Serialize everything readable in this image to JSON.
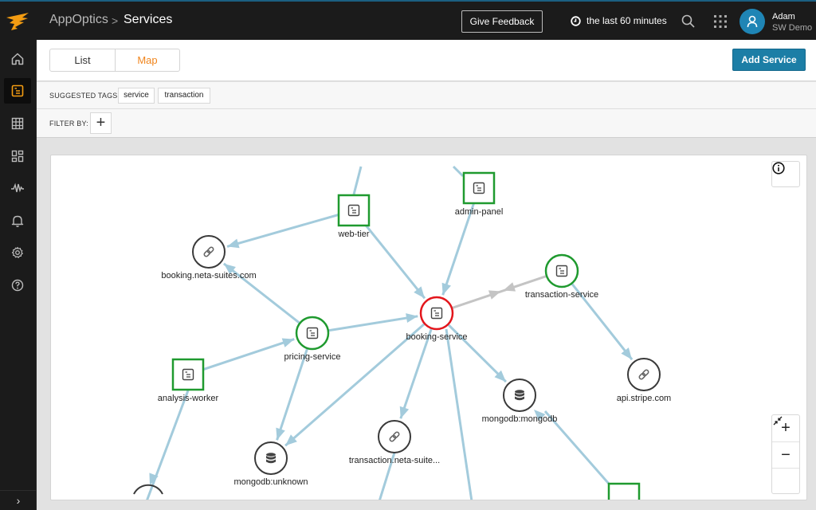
{
  "topbar": {
    "app_name": "AppOptics",
    "separator": ">",
    "page": "Services",
    "feedback_label": "Give Feedback",
    "time_range": "the last 60 minutes",
    "user_name": "Adam",
    "user_org": "SW Demo"
  },
  "sidebar": {
    "items": [
      {
        "name": "home",
        "icon": "home-icon",
        "active": false
      },
      {
        "name": "services",
        "icon": "services-icon",
        "active": true
      },
      {
        "name": "grid",
        "icon": "grid-icon",
        "active": false
      },
      {
        "name": "dashboards",
        "icon": "dashboards-icon",
        "active": false
      },
      {
        "name": "metrics",
        "icon": "pulse-icon",
        "active": false
      },
      {
        "name": "alerts",
        "icon": "bell-icon",
        "active": false
      },
      {
        "name": "settings",
        "icon": "gear-icon",
        "active": false
      },
      {
        "name": "help",
        "icon": "help-icon",
        "active": false
      }
    ],
    "expand_glyph": "›"
  },
  "header": {
    "tabs": [
      {
        "label": "List",
        "active": false
      },
      {
        "label": "Map",
        "active": true
      }
    ],
    "add_service_label": "Add Service"
  },
  "tags": {
    "label": "SUGGESTED TAGS:",
    "items": [
      "service",
      "transaction"
    ]
  },
  "filter": {
    "label": "FILTER BY:",
    "add_glyph": "+"
  },
  "map": {
    "zoom_in": "+",
    "zoom_out": "−",
    "colors": {
      "edge": "#a3cbdc",
      "edge_muted": "#c4c4c4",
      "healthy": "#1f9a2f",
      "error": "#e3161c",
      "neutral": "#3a3a3a"
    },
    "nodes": [
      {
        "id": "web-tier",
        "label": "web-tier",
        "shape": "square",
        "icon": "service-icon",
        "status": "healthy"
      },
      {
        "id": "admin-panel",
        "label": "admin-panel",
        "shape": "square",
        "icon": "service-icon",
        "status": "healthy"
      },
      {
        "id": "booking-neta",
        "label": "booking.neta-suites.com",
        "shape": "circle",
        "icon": "link-icon",
        "status": "neutral"
      },
      {
        "id": "transaction-service",
        "label": "transaction-service",
        "shape": "circle",
        "icon": "service-icon",
        "status": "healthy"
      },
      {
        "id": "booking-service",
        "label": "booking-service",
        "shape": "circle",
        "icon": "service-icon",
        "status": "error"
      },
      {
        "id": "pricing-service",
        "label": "pricing-service",
        "shape": "circle",
        "icon": "service-icon",
        "status": "healthy"
      },
      {
        "id": "analysis-worker",
        "label": "analysis-worker",
        "shape": "square",
        "icon": "service-icon",
        "status": "healthy"
      },
      {
        "id": "api-stripe",
        "label": "api.stripe.com",
        "shape": "circle",
        "icon": "link-icon",
        "status": "neutral"
      },
      {
        "id": "mongodb-mongodb",
        "label": "mongodb:mongodb",
        "shape": "circle",
        "icon": "database-icon",
        "status": "neutral"
      },
      {
        "id": "transaction-neta",
        "label": "transaction.neta-suite...",
        "shape": "circle",
        "icon": "link-icon",
        "status": "neutral"
      },
      {
        "id": "mongodb-unknown",
        "label": "mongodb:unknown",
        "shape": "circle",
        "icon": "database-icon",
        "status": "neutral"
      }
    ],
    "edges": [
      {
        "from": "web-tier",
        "to": "booking-neta"
      },
      {
        "from": "web-tier",
        "to": "booking-service"
      },
      {
        "from": "admin-panel",
        "to": "booking-service"
      },
      {
        "from": "transaction-service",
        "to": "booking-service",
        "muted": true
      },
      {
        "from": "transaction-service",
        "to": "api-stripe"
      },
      {
        "from": "pricing-service",
        "to": "booking-neta"
      },
      {
        "from": "pricing-service",
        "to": "booking-service"
      },
      {
        "from": "pricing-service",
        "to": "mongodb-unknown"
      },
      {
        "from": "analysis-worker",
        "to": "pricing-service"
      },
      {
        "from": "booking-service",
        "to": "mongodb-mongodb"
      },
      {
        "from": "booking-service",
        "to": "transaction-neta"
      },
      {
        "from": "booking-service",
        "to": "mongodb-unknown"
      }
    ]
  }
}
